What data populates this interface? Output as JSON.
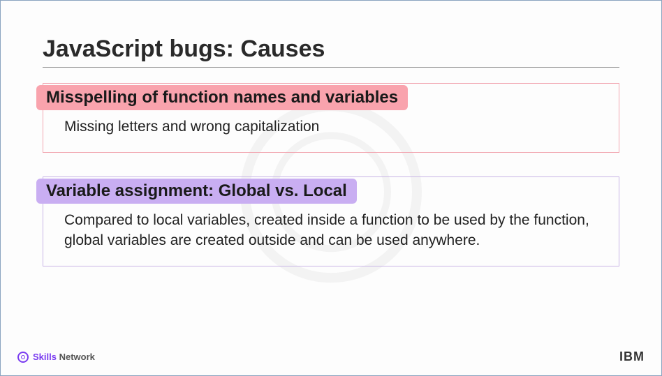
{
  "slide": {
    "title": "JavaScript bugs: Causes",
    "cards": [
      {
        "heading": "Misspelling of function names and variables",
        "body": "Missing letters and wrong capitalization"
      },
      {
        "heading": "Variable assignment: Global vs. Local",
        "body": "Compared to local variables, created inside a function to be used by the function, global variables are created outside and can be used anywhere."
      }
    ]
  },
  "footer": {
    "skills": "Skills",
    "network": "Network",
    "brand": "IBM"
  }
}
